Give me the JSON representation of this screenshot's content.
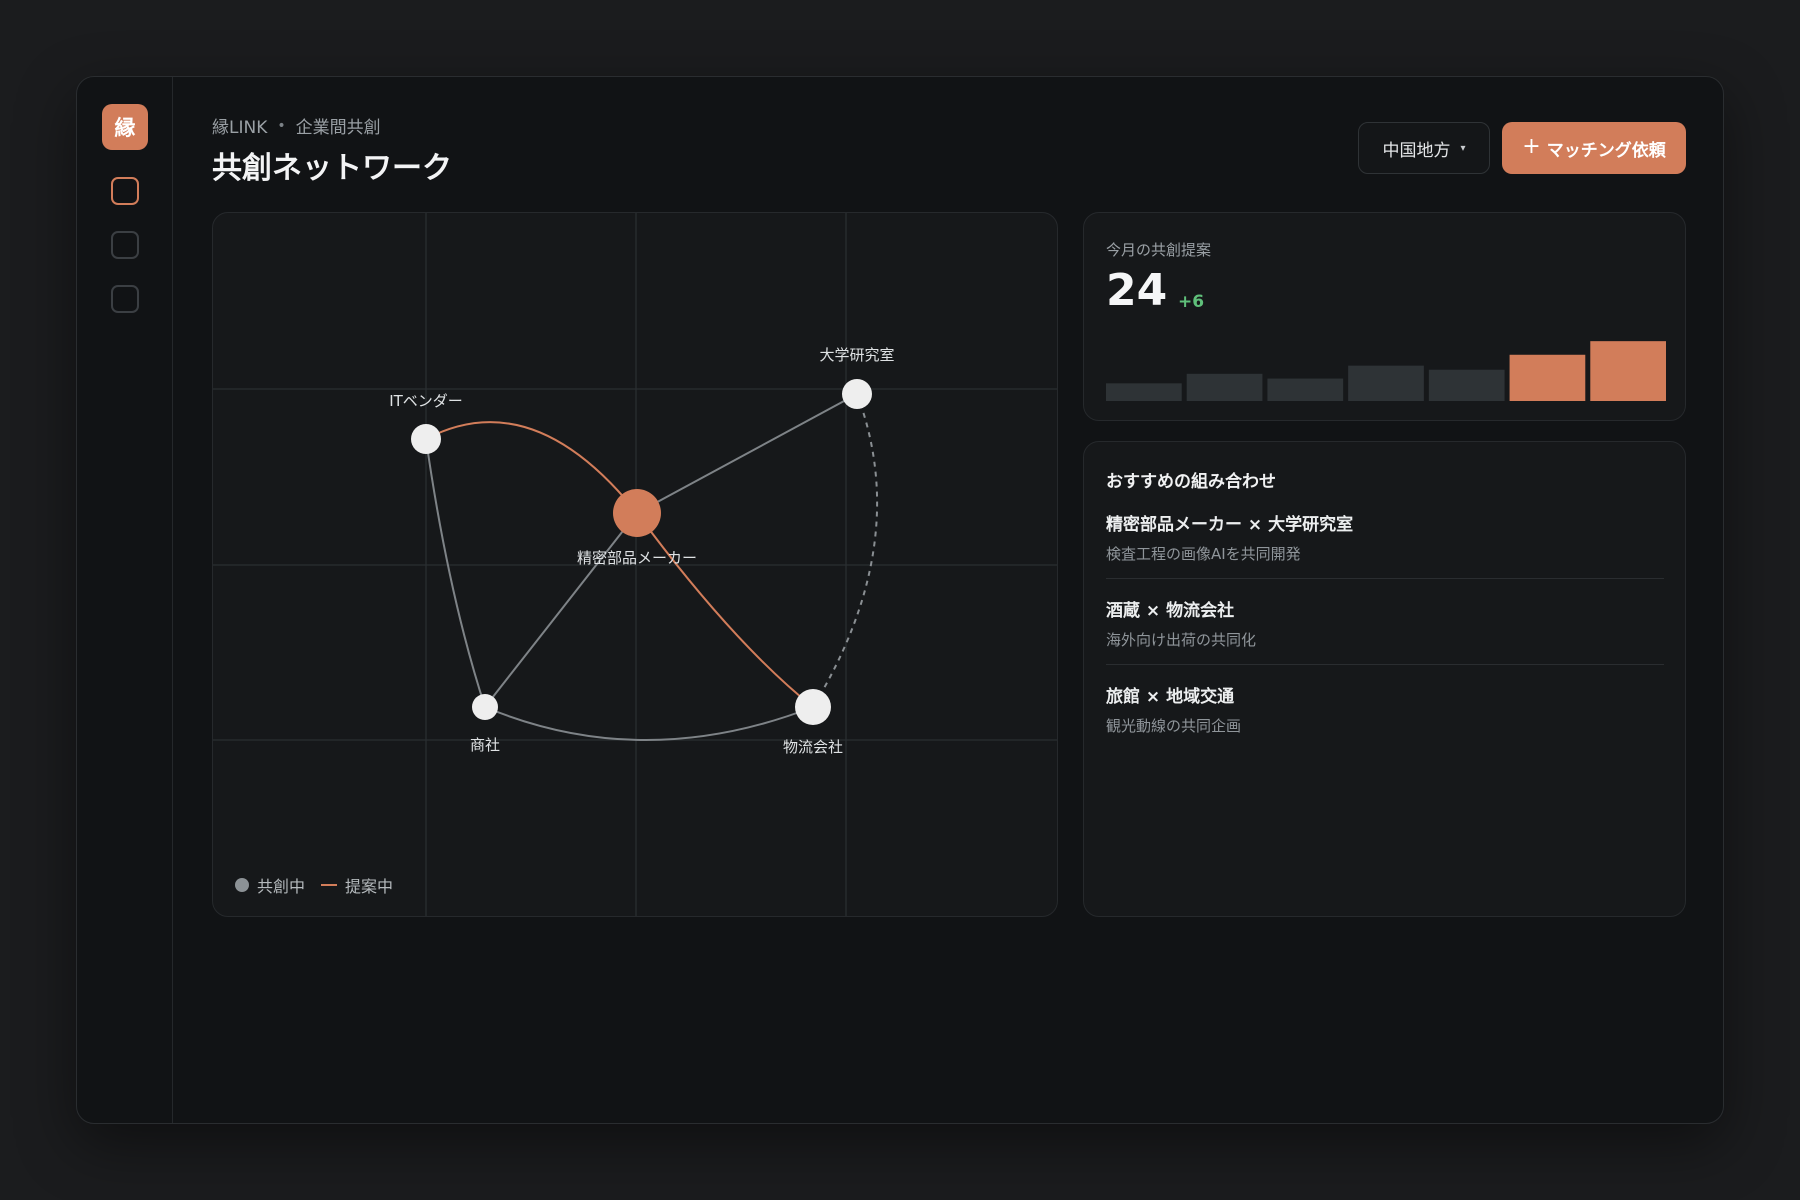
{
  "app": {
    "logo_char": "縁",
    "breadcrumb": [
      "縁LINK",
      "企業間共創"
    ],
    "breadcrumb_separator": "•",
    "title": "共創ネットワーク"
  },
  "header": {
    "region_label": "中国地方",
    "region_caret": "▾",
    "match_plus": "+",
    "match_label": "マッチング依頼"
  },
  "rail": {
    "items": [
      "logo",
      "nav-item-1",
      "nav-item-2",
      "nav-item-3"
    ],
    "active_index": 1
  },
  "network": {
    "nodes": [
      {
        "id": "maker",
        "label": "精密部品メーカー",
        "kind": "focus"
      },
      {
        "id": "lab",
        "label": "大学研究室",
        "kind": "normal"
      },
      {
        "id": "it",
        "label": "ITベンダー",
        "kind": "normal"
      },
      {
        "id": "trading",
        "label": "商社",
        "kind": "normal"
      },
      {
        "id": "logistics",
        "label": "物流会社",
        "kind": "normal"
      }
    ],
    "edges": [
      {
        "from": "maker",
        "to": "lab",
        "status": "active"
      },
      {
        "from": "maker",
        "to": "trading",
        "status": "active"
      },
      {
        "from": "it",
        "to": "trading",
        "status": "active"
      },
      {
        "from": "trading",
        "to": "logistics",
        "status": "active"
      },
      {
        "from": "it",
        "to": "maker",
        "status": "proposed"
      },
      {
        "from": "maker",
        "to": "logistics",
        "status": "proposed"
      },
      {
        "from": "lab",
        "to": "logistics",
        "status": "candidate"
      }
    ],
    "legend": {
      "active": "共創中",
      "proposed": "提案中"
    },
    "colors": {
      "focus": "#d27d5a",
      "node": "#eeeeee",
      "active_edge": "#7e8387",
      "proposed_edge": "#d27d5a",
      "candidate_edge": "#8a8f93"
    }
  },
  "stats": {
    "label": "今月の共創提案",
    "value": "24",
    "delta": "+6",
    "bar_levels": [
      0.26,
      0.4,
      0.33,
      0.52,
      0.46,
      0.68,
      0.88
    ],
    "highlight_from": 5,
    "colors": {
      "bar": "#2e3336",
      "highlight": "#d27d5a"
    }
  },
  "recommendations": {
    "title": "おすすめの組み合わせ",
    "items": [
      {
        "pair": "精密部品メーカー × 大学研究室",
        "desc": "検査工程の画像AIを共同開発"
      },
      {
        "pair": "酒蔵 × 物流会社",
        "desc": "海外向け出荷の共同化"
      },
      {
        "pair": "旅館 × 地域交通",
        "desc": "観光動線の共同企画"
      }
    ]
  }
}
